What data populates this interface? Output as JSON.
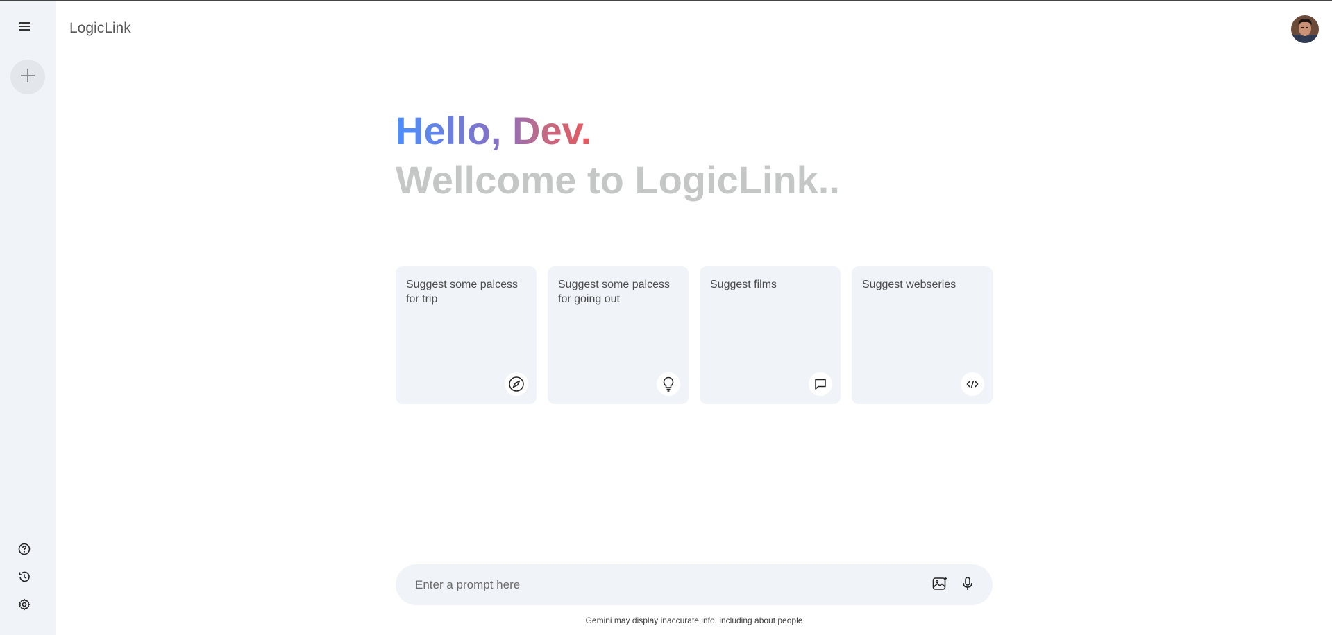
{
  "sidebar": {
    "menu_icon": "hamburger-menu-icon",
    "new_chat_icon": "plus-icon",
    "bottom_items": [
      {
        "icon": "help-icon"
      },
      {
        "icon": "history-icon"
      },
      {
        "icon": "settings-icon"
      }
    ]
  },
  "header": {
    "brand": "LogicLink",
    "avatar": "user-avatar"
  },
  "greeting": {
    "hello": "Hello, Dev.",
    "subtitle": "Wellcome to LogicLink.."
  },
  "cards": [
    {
      "text": "Suggest some palcess for trip",
      "icon": "compass-icon"
    },
    {
      "text": "Suggest some palcess for going out",
      "icon": "bulb-icon"
    },
    {
      "text": "Suggest films",
      "icon": "message-icon"
    },
    {
      "text": "Suggest webseries",
      "icon": "code-icon"
    }
  ],
  "prompt": {
    "placeholder": "Enter a prompt here",
    "value": "",
    "gallery_icon": "image-icon",
    "mic_icon": "mic-icon"
  },
  "footer": {
    "disclaimer": "Gemini may display inaccurate info, including about people"
  },
  "colors": {
    "sidebar_bg": "#f0f4f9",
    "card_bg": "#f0f4f9",
    "greeting_start": "#4b90ff",
    "greeting_end": "#e8575b",
    "subtitle": "#c4c7c5"
  }
}
